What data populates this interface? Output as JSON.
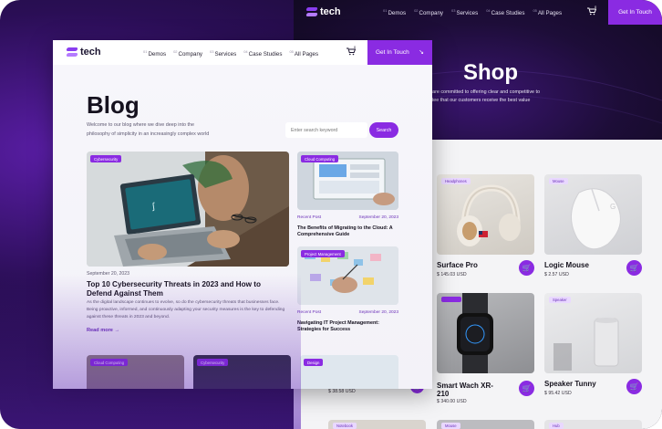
{
  "shop": {
    "nav": {
      "logo": "tech",
      "links": [
        {
          "num": "01",
          "label": "Demos"
        },
        {
          "num": "02",
          "label": "Company"
        },
        {
          "num": "03",
          "label": "Services"
        },
        {
          "num": "04",
          "label": "Case Studies"
        },
        {
          "num": "05",
          "label": "All Pages"
        }
      ],
      "cart_count": "0",
      "cta": "Get In Touch"
    },
    "hero": {
      "title": "Shop",
      "subtitle": "ch, we are committed to offering clear and competitive to guarantee that our customers receive the best value"
    },
    "products": [
      {
        "tag": "Headphones",
        "name": "Surface Pro",
        "price": "$ 145.03 USD"
      },
      {
        "tag": "Mouse",
        "name": "Logic Mouse",
        "price": "$ 2.57 USD"
      },
      {
        "tag": "",
        "name": "Smart Wach XR-210",
        "price": "$ 340.00 USD"
      },
      {
        "tag": "Speaker",
        "name": "Speaker Tunny",
        "price": "$ 95.42 USD"
      }
    ],
    "partial_price": "$ 38.58 USD",
    "bottom_tags": [
      "Notebook",
      "Mouse",
      "Hub"
    ]
  },
  "blog": {
    "nav": {
      "logo": "tech",
      "links": [
        {
          "num": "01",
          "label": "Demos"
        },
        {
          "num": "02",
          "label": "Company"
        },
        {
          "num": "03",
          "label": "Services"
        },
        {
          "num": "04",
          "label": "Case Studies"
        },
        {
          "num": "05",
          "label": "All Pages"
        }
      ],
      "cart_count": "0",
      "cta": "Get In Touch",
      "cta_arrow": "↘"
    },
    "title": "Blog",
    "intro": "Welcome to our blog where we dive deep into the philosophy of simplicity in an increasingly complex world",
    "search": {
      "placeholder": "Enter search keyword",
      "button": "Search"
    },
    "featured": {
      "tag": "Cybersecurity",
      "date": "September 20, 2023",
      "title": "Top 10 Cybersecurity Threats in 2023 and How to Defend Against Them",
      "description": "As the digital landscape continues to evolve, so do the cybersecurity threats that businesses face. Being proactive, informed, and continuously adapting your security measures is the key to defending against these threats in 2023 and beyond.",
      "read_more": "Read more →"
    },
    "side_posts": [
      {
        "tag": "Cloud Computing",
        "category": "Recent Post",
        "date": "September 20, 2023",
        "title": "The Benefits of Migrating to the Cloud: A Comprehensive Guide"
      },
      {
        "tag": "Project Management",
        "category": "Recent Post",
        "date": "September 20, 2023",
        "title": "Navigating IT Project Management: Strategies for Success"
      }
    ],
    "bottom_tags": [
      "Cloud Computing",
      "Cybersecurity",
      "Design"
    ]
  }
}
